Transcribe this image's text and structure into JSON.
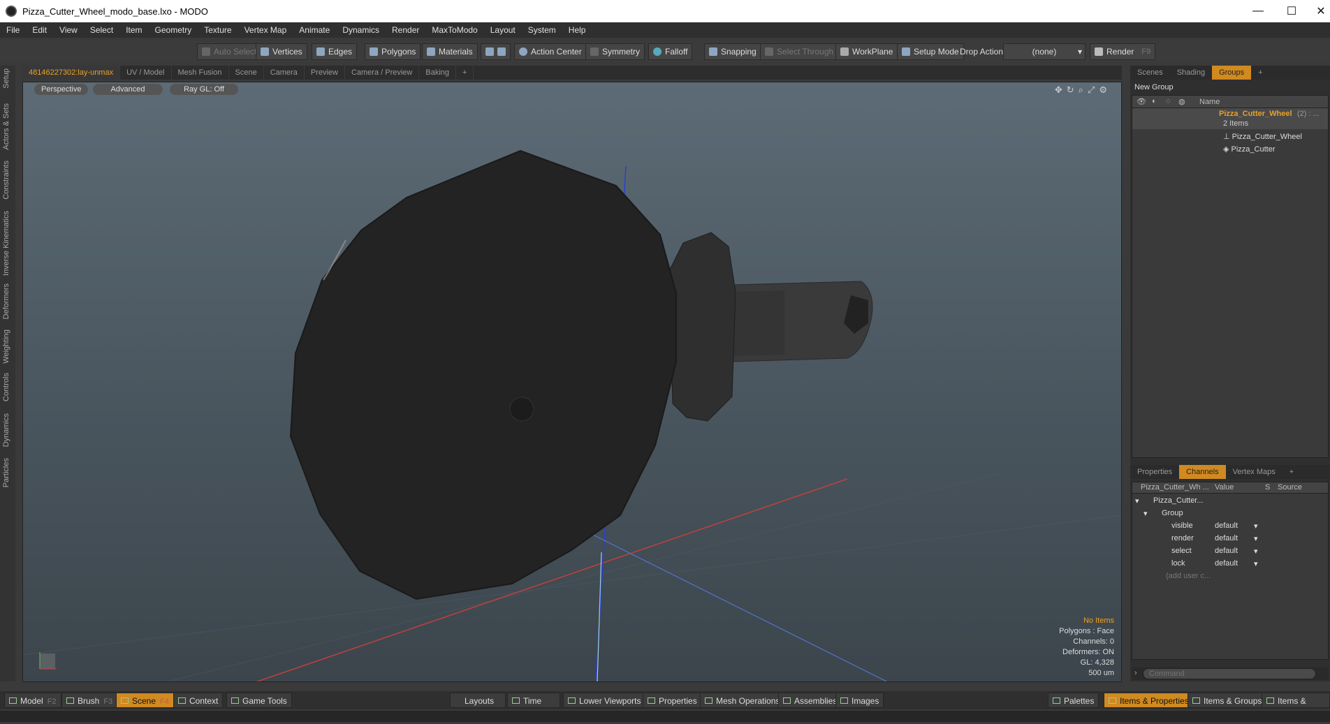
{
  "window": {
    "title": "Pizza_Cutter_Wheel_modo_base.lxo - MODO",
    "minimize": "—",
    "maximize": "☐",
    "close": "✕"
  },
  "menu": [
    "File",
    "Edit",
    "View",
    "Select",
    "Item",
    "Geometry",
    "Texture",
    "Vertex Map",
    "Animate",
    "Dynamics",
    "Render",
    "MaxToModo",
    "Layout",
    "System",
    "Help"
  ],
  "toolbar": {
    "auto_select": "Auto Select",
    "vertices": "Vertices",
    "edges": "Edges",
    "polygons": "Polygons",
    "materials": "Materials",
    "action_center": "Action Center",
    "symmetry": "Symmetry",
    "falloff": "Falloff",
    "snapping": "Snapping",
    "select_through": "Select Through",
    "workplane": "WorkPlane",
    "setup_mode": "Setup Mode",
    "drop_action": "Drop Action",
    "drop_value": "(none)",
    "render": "Render",
    "render_key": "F9"
  },
  "view_tabs": [
    "48146227302:lay-unmax",
    "UV / Model",
    "Mesh Fusion",
    "Scene",
    "Camera",
    "Preview",
    "Camera / Preview",
    "Baking",
    "+"
  ],
  "left_tabs": [
    "Setup",
    "Actors & Sets",
    "Constraints",
    "Inverse Kinematics",
    "Deformers",
    "Weighting",
    "Controls",
    "Dynamics",
    "Particles"
  ],
  "viewport": {
    "view_mode": "Perspective",
    "shading": "Advanced",
    "raygl": "Ray GL: Off",
    "stats": {
      "items": "No Items",
      "polygons": "Polygons : Face",
      "channels": "Channels: 0",
      "deformers": "Deformers: ON",
      "gl": "GL: 4,328",
      "scale": "500 um"
    }
  },
  "right_top_tabs": [
    "Scenes",
    "Shading",
    "Groups",
    "+"
  ],
  "groups": {
    "new_group": "New Group",
    "col_name": "Name",
    "root_name": "Pizza_Cutter_Wheel",
    "root_count": "(2) : ...",
    "root_sub": "2 Items",
    "children": [
      "Pizza_Cutter_Wheel",
      "Pizza_Cutter"
    ]
  },
  "right_bottom_tabs": [
    "Properties",
    "Channels",
    "Vertex Maps",
    "+"
  ],
  "channels": {
    "col_item": "Pizza_Cutter_Wh ...",
    "col_value": "Value",
    "col_s": "S",
    "col_source": "Source",
    "root": "Pizza_Cutter...",
    "group": "Group",
    "rows": [
      {
        "name": "visible",
        "value": "default"
      },
      {
        "name": "render",
        "value": "default"
      },
      {
        "name": "select",
        "value": "default"
      },
      {
        "name": "lock",
        "value": "default"
      }
    ],
    "add_user": "(add user c..."
  },
  "command": {
    "placeholder": "Command"
  },
  "bottom": {
    "model": "Model",
    "model_key": "F2",
    "brush": "Brush",
    "brush_key": "F3",
    "scene": "Scene",
    "scene_key": "F4",
    "context": "Context",
    "game_tools": "Game Tools",
    "layouts": "Layouts",
    "time": "Time",
    "lower_viewports": "Lower Viewports",
    "properties": "Properties",
    "mesh_operations": "Mesh Operations",
    "assemblies": "Assemblies",
    "images": "Images",
    "palettes": "Palettes",
    "items_properties": "Items & Properties",
    "items_groups": "Items & Groups",
    "items_shading": "Items & Shading"
  },
  "colors": {
    "accent": "#d08a20",
    "axis_x": "#c0392b",
    "axis_y": "#2a3fd0",
    "axis_z": "#5070c0"
  }
}
